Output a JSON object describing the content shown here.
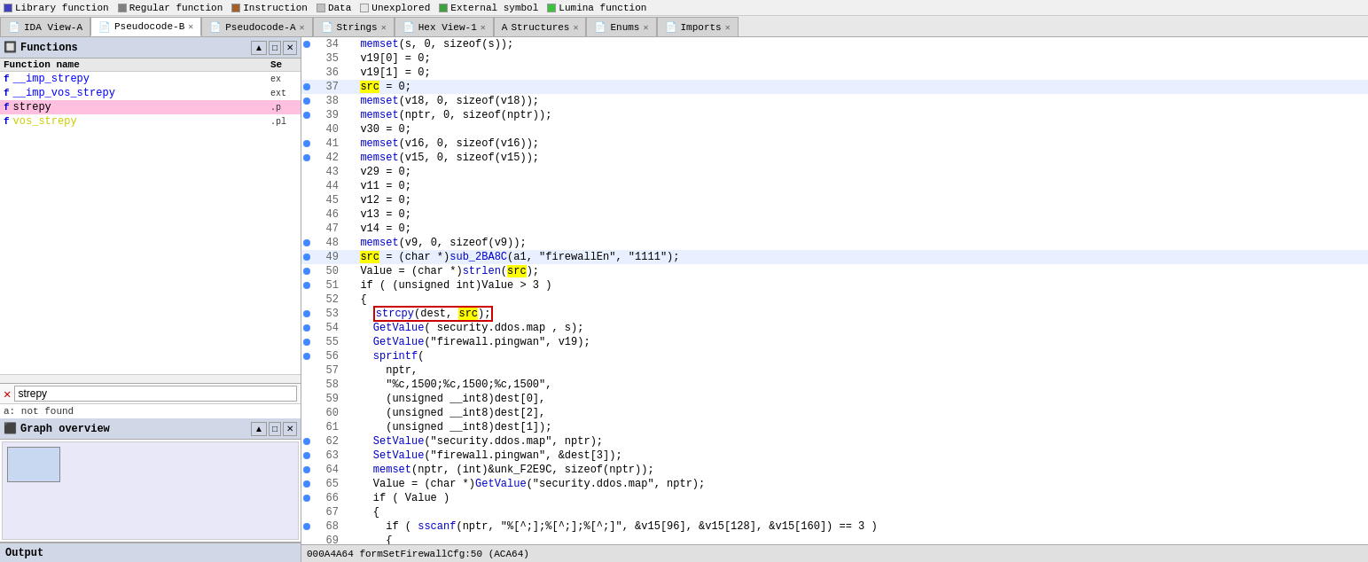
{
  "legend": {
    "items": [
      {
        "label": "Library function",
        "color": "#4040c0"
      },
      {
        "label": "Regular function",
        "color": "#808080"
      },
      {
        "label": "Instruction",
        "color": "#a06030"
      },
      {
        "label": "Data",
        "color": "#c0c0c0"
      },
      {
        "label": "Unexplored",
        "color": "#e0e0e0"
      },
      {
        "label": "External symbol",
        "color": "#40a040"
      },
      {
        "label": "Lumina function",
        "color": "#40c040"
      }
    ]
  },
  "tabs": [
    {
      "id": "ida-view-a",
      "label": "IDA View-A",
      "icon": "📄",
      "active": false,
      "closable": false
    },
    {
      "id": "pseudocode-b",
      "label": "Pseudocode-B",
      "icon": "📄",
      "active": true,
      "closable": true
    },
    {
      "id": "pseudocode-a",
      "label": "Pseudocode-A",
      "icon": "📄",
      "active": false,
      "closable": true
    },
    {
      "id": "strings",
      "label": "Strings",
      "icon": "📄",
      "active": false,
      "closable": true
    },
    {
      "id": "hex-view-1",
      "label": "Hex View-1",
      "icon": "📄",
      "active": false,
      "closable": true
    },
    {
      "id": "structures",
      "label": "Structures",
      "icon": "📄",
      "active": false,
      "closable": true
    },
    {
      "id": "enums",
      "label": "Enums",
      "icon": "📄",
      "active": false,
      "closable": true
    },
    {
      "id": "imports",
      "label": "Imports",
      "icon": "📄",
      "active": false,
      "closable": true
    }
  ],
  "functions_panel": {
    "title": "Functions",
    "col_name": "Function name",
    "col_seg": "Se",
    "items": [
      {
        "name": "__imp_strepy",
        "seg": "ex",
        "type": "lib",
        "selected": false,
        "nameColor": "blue"
      },
      {
        "name": "__imp_vos_strepy",
        "seg": "ext",
        "type": "lib",
        "selected": false,
        "nameColor": "blue"
      },
      {
        "name": "strepy",
        "seg": ".p",
        "type": "lib",
        "selected": true,
        "nameColor": "normal"
      },
      {
        "name": "vos_strepy",
        "seg": ".pl",
        "type": "lib",
        "selected": false,
        "nameColor": "yellow"
      }
    ]
  },
  "search": {
    "value": "strepy",
    "not_found": "a: not found"
  },
  "graph_panel": {
    "title": "Graph overview"
  },
  "output_bar": {
    "label": "Output"
  },
  "code": {
    "lines": [
      {
        "num": 34,
        "dot": true,
        "content": "  memset(s, 0, sizeof(s));",
        "highlight": false
      },
      {
        "num": 35,
        "dot": false,
        "content": "  v19[0] = 0;",
        "highlight": false
      },
      {
        "num": 36,
        "dot": false,
        "content": "  v19[1] = 0;",
        "highlight": false
      },
      {
        "num": 37,
        "dot": true,
        "content": "  src = 0;",
        "highlight": true,
        "srcHighlight": false
      },
      {
        "num": 38,
        "dot": true,
        "content": "  memset(v18, 0, sizeof(v18));",
        "highlight": false
      },
      {
        "num": 39,
        "dot": true,
        "content": "  memset(nptr, 0, sizeof(nptr));",
        "highlight": false
      },
      {
        "num": 40,
        "dot": false,
        "content": "  v30 = 0;",
        "highlight": false
      },
      {
        "num": 41,
        "dot": true,
        "content": "  memset(v16, 0, sizeof(v16));",
        "highlight": false
      },
      {
        "num": 42,
        "dot": true,
        "content": "  memset(v15, 0, sizeof(v15));",
        "highlight": false
      },
      {
        "num": 43,
        "dot": false,
        "content": "  v29 = 0;",
        "highlight": false
      },
      {
        "num": 44,
        "dot": false,
        "content": "  v11 = 0;",
        "highlight": false
      },
      {
        "num": 45,
        "dot": false,
        "content": "  v12 = 0;",
        "highlight": false
      },
      {
        "num": 46,
        "dot": false,
        "content": "  v13 = 0;",
        "highlight": false
      },
      {
        "num": 47,
        "dot": false,
        "content": "  v14 = 0;",
        "highlight": false
      },
      {
        "num": 48,
        "dot": true,
        "content": "  memset(v9, 0, sizeof(v9));",
        "highlight": false
      },
      {
        "num": 49,
        "dot": true,
        "content": "  src = (char *)sub_2BA8C(a1, \"firewallEn\", \"1111\");",
        "highlight": true,
        "srcHighlight": true
      },
      {
        "num": 50,
        "dot": true,
        "content": "  Value = (char *)strlen(src);",
        "highlight": false,
        "srcInline": true
      },
      {
        "num": 51,
        "dot": true,
        "content": "  if ( (unsigned int)Value > 3 )",
        "highlight": false
      },
      {
        "num": 52,
        "dot": false,
        "content": "  {",
        "highlight": false
      },
      {
        "num": 53,
        "dot": true,
        "content": "    strcpy(dest, src);",
        "highlight": false,
        "redBox": true
      },
      {
        "num": 54,
        "dot": true,
        "content": "    GetValue( security.ddos.map , s);",
        "highlight": false
      },
      {
        "num": 55,
        "dot": true,
        "content": "    GetValue(\"firewall.pingwan\", v19);",
        "highlight": false
      },
      {
        "num": 56,
        "dot": true,
        "content": "    sprintf(",
        "highlight": false
      },
      {
        "num": 57,
        "dot": false,
        "content": "      nptr,",
        "highlight": false
      },
      {
        "num": 58,
        "dot": false,
        "content": "      \"%c,1500;%c,1500;%c,1500\",",
        "highlight": false
      },
      {
        "num": 59,
        "dot": false,
        "content": "      (unsigned __int8)dest[0],",
        "highlight": false
      },
      {
        "num": 60,
        "dot": false,
        "content": "      (unsigned __int8)dest[2],",
        "highlight": false
      },
      {
        "num": 61,
        "dot": false,
        "content": "      (unsigned __int8)dest[1]);",
        "highlight": false
      },
      {
        "num": 62,
        "dot": true,
        "content": "    SetValue(\"security.ddos.map\", nptr);",
        "highlight": false
      },
      {
        "num": 63,
        "dot": true,
        "content": "    SetValue(\"firewall.pingwan\", &dest[3]);",
        "highlight": false
      },
      {
        "num": 64,
        "dot": true,
        "content": "    memset(nptr, (int)&unk_F2E9C, sizeof(nptr));",
        "highlight": false
      },
      {
        "num": 65,
        "dot": true,
        "content": "    Value = (char *)GetValue(\"security.ddos.map\", nptr);",
        "highlight": false
      },
      {
        "num": 66,
        "dot": true,
        "content": "    if ( Value )",
        "highlight": false
      },
      {
        "num": 67,
        "dot": false,
        "content": "    {",
        "highlight": false
      },
      {
        "num": 68,
        "dot": true,
        "content": "      if ( sscanf(nptr, \"%[^;];%[^;];%[^;]\", &v15[96], &v15[128], &v15[160]) == 3 )",
        "highlight": false
      },
      {
        "num": 69,
        "dot": false,
        "content": "      {",
        "highlight": false
      }
    ],
    "status": "000A4A64 formSetFirewallCfg:50 (ACA64)"
  }
}
